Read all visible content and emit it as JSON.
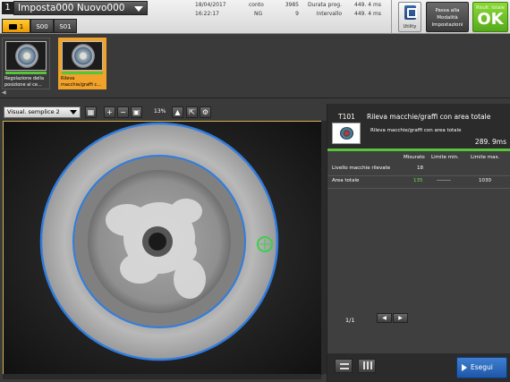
{
  "header": {
    "scene_number": "1",
    "scene_name": "Imposta000  Nuovo000",
    "tabs": [
      {
        "label": "1"
      },
      {
        "label": "S00"
      },
      {
        "label": "S01"
      }
    ],
    "date": "18/04/2017",
    "time": "16:22:17",
    "counter_label": "conto",
    "counter_value": "3985",
    "ng_label": "NG",
    "ng_value": "9",
    "duration_label": "Durata prog.",
    "duration_value": "449. 4  ms",
    "interval_label": "Intervallo",
    "interval_value": "449. 4  ms",
    "utility_label": "Utility",
    "mode_button": {
      "line1": "Passa alla",
      "line2": "Modalità",
      "line3": "Impostazioni"
    },
    "result_label": "Risult. totale",
    "result_value": "OK"
  },
  "thumbnails": [
    {
      "label": "Regolazione della posizione al ce..."
    },
    {
      "label": "Rileva macchie/graffi c..."
    }
  ],
  "toolbar": {
    "view_select": "Visual. semplice 2",
    "zoom": "13%"
  },
  "unit": {
    "id": "T101",
    "name": "Rileva macchie/graffi con area totale",
    "subtitle": "Rileva macchie/graffi con area totale",
    "time": "289. 9ms"
  },
  "table": {
    "headers": [
      "Misurato",
      "Limite min.",
      "Limite max."
    ],
    "rows": [
      {
        "label": "Livello macchie rilevate",
        "measured": "18",
        "min": "",
        "max": ""
      },
      {
        "label": "Area totale",
        "measured": "135",
        "min": "--------",
        "max": "1030"
      }
    ]
  },
  "pager": {
    "text": "1/1"
  },
  "run_button": "Esegui",
  "colors": {
    "accent_ok": "#58c43a",
    "selection": "#f0a22a",
    "run": "#2f6fc4",
    "circle": "#2f7de0"
  }
}
